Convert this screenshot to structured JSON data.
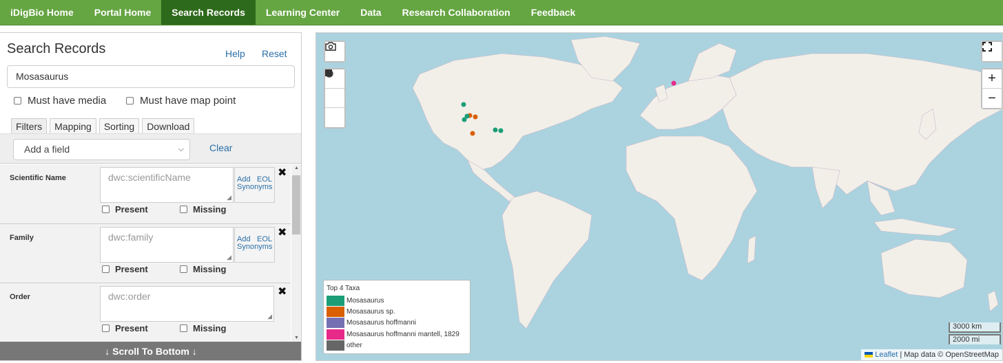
{
  "nav": {
    "items": [
      "iDigBio Home",
      "Portal Home",
      "Search Records",
      "Learning Center",
      "Data",
      "Research Collaboration",
      "Feedback"
    ],
    "active": "Search Records"
  },
  "panel": {
    "title": "Search Records",
    "help": "Help",
    "reset": "Reset",
    "search_value": "Mosasaurus",
    "must_have_media": "Must have media",
    "must_have_map_point": "Must have map point",
    "tabs": [
      "Filters",
      "Mapping",
      "Sorting",
      "Download"
    ],
    "add_field": "Add a field",
    "clear": "Clear",
    "filters": [
      {
        "label": "Scientific Name",
        "placeholder": "dwc:scientificName",
        "eol": true
      },
      {
        "label": "Family",
        "placeholder": "dwc:family",
        "eol": true
      },
      {
        "label": "Order",
        "placeholder": "dwc:order",
        "eol": false
      }
    ],
    "eol_add": "Add",
    "eol_eol": "EOL",
    "eol_synonyms": "Synonyms",
    "present": "Present",
    "missing": "Missing",
    "scroll_bottom": "↓ Scroll To Bottom ↓"
  },
  "map": {
    "legend_title": "Top 4 Taxa",
    "legend": [
      {
        "name": "Mosasaurus",
        "color": "#1b9e77"
      },
      {
        "name": "Mosasaurus sp.",
        "color": "#d95f02"
      },
      {
        "name": "Mosasaurus hoffmanni",
        "color": "#7570b3"
      },
      {
        "name": "Mosasaurus hoffmanni mantell, 1829",
        "color": "#e7298a"
      },
      {
        "name": "other",
        "color": "#666666"
      }
    ],
    "scale_km": "3000 km",
    "scale_mi": "2000 mi",
    "attribution_leaflet": "Leaflet",
    "attribution_rest": " | Map data © OpenStreetMap",
    "zoom_in": "+",
    "zoom_out": "−"
  }
}
